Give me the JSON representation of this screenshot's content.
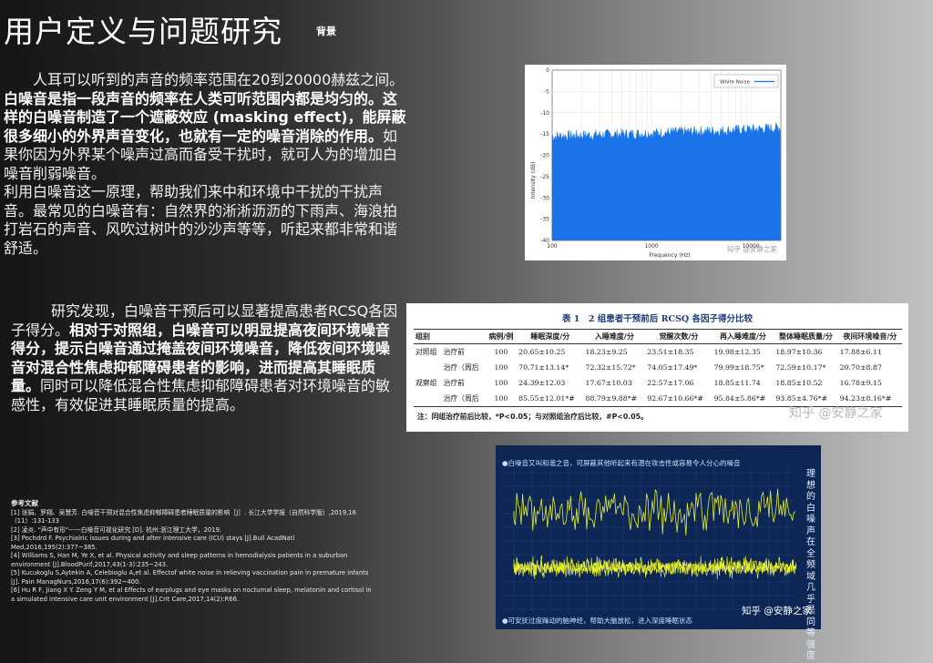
{
  "header": {
    "title": "用户定义与问题研究",
    "subtitle": "背景"
  },
  "para1": {
    "s1": "人耳可以听到的声音的频率范围在20到20000赫兹之间。",
    "s2": "白噪音是指一段声音的频率在人类可听范围内都是均匀的。这样的白噪音制造了一个遮蔽效应 (masking effect)，能屏蔽很多细小的外界声音变化，也就有一定的噪音消除的作用。",
    "s3": "如果你因为外界某个噪声过高而备受干扰时，就可人为的增加白噪音削弱噪音。",
    "s4": "利用白噪音这一原理，帮助我们来中和环境中干扰的干扰声音。最常见的白噪音有：自然界的淅淅沥沥的下雨声、海浪拍打岩石的声音、风吹过树叶的沙沙声等等，听起来都非常和谐舒适。"
  },
  "para2": {
    "s1": "研究发现，白噪音干预后可以显著提高患者RCSQ各因子得分。",
    "s2": "相对于对照组，白噪音可以明显提高夜间环境噪音得分，提示白噪音通过掩盖夜间环境噪音，降低夜间环境噪音对混合性焦虑抑郁障碍患者的影响，进而提高其睡眠质量。",
    "s3": "同时可以降低混合性焦虑抑郁障碍患者对环境噪音的敏感性，有效促进其睡眠质量的提高。"
  },
  "refs": {
    "heading": "参考文献",
    "items": [
      "[1] 张娟、罗翔、吴慧芳. 白噪音干预对混合性焦虑抑郁障碍患者睡眠质量的影响［J］. 长江大学学报（自然科学版）,2019,16（11）:131-133",
      "[2] 凌炎. \"声中有形\"——白噪音可视化研究 [D]. 杭州:浙江理工大学，2019.",
      "[3] Pochdrd F. Psychialric issues during and after intensive care (ICU) stays [J].Bull AcadNatl Med,2016,195(2):377~385.",
      "[4] Williams S, Han M, Ye X, et al. Physical activity and sleep patterns in hemodialysis patients in a suburban environment [J].BloodPurif,2017,43(1-3):235~243.",
      "[5] Kucukoglu S,Aytekin A, Celebioglu A,et al. Effectof white noise in relieving vaccination pain in premature infants [J]. Pain ManagNurs,2016,17(6):392~400.",
      "[6] Hu R F, Jiang X Y. Zeng Y M, et al Effects of earplugs and eye masks on nocturnal sleep, melatonin and cortisol in a simulated intensive care unit environment [J].Crit Care,2017,14(2):R66."
    ]
  },
  "chart_data": {
    "type": "area",
    "title": "",
    "xlabel": "Frequency (Hz)",
    "ylabel": "Intensity (dB)",
    "xscale": "log",
    "xlim": [
      100,
      20000
    ],
    "ylim": [
      -40,
      0
    ],
    "xticks": [
      "100",
      "1000",
      "10000"
    ],
    "yticks": [
      "0",
      "-5",
      "-10",
      "-15",
      "-20",
      "-25",
      "-30",
      "-35",
      "-40"
    ],
    "legend_position": "top-right",
    "series": [
      {
        "name": "White Noise",
        "color": "#1a73e8",
        "x": [
          100,
          200,
          500,
          1000,
          2000,
          5000,
          10000,
          20000
        ],
        "y": [
          -15.5,
          -15.3,
          -15.0,
          -14.8,
          -14.5,
          -14.2,
          -13.9,
          -13.5
        ]
      }
    ],
    "watermark": "知乎 @安静之家"
  },
  "table": {
    "title": "表 1　2 组患者干预前后 RCSQ 各因子得分比较",
    "headers": [
      "组别",
      "",
      "病例/例",
      "睡眠深度/分",
      "入睡难度/分",
      "觉醒次数/分",
      "再入睡难度/分",
      "整体睡眠质量/分",
      "夜间环境噪音/分"
    ],
    "rows": [
      [
        "对照组",
        "治疗前",
        "100",
        "20.65±10.25",
        "18.23±9.25",
        "23.51±18.35",
        "19.98±12.35",
        "18.97±10.36",
        "17.88±6.11"
      ],
      [
        "",
        "治疗（周后",
        "100",
        "70.71±13.14*",
        "72.32±15.72*",
        "74.05±17.49*",
        "79.99±18.75*",
        "72.59±10.17*",
        "20.70±8.87"
      ],
      [
        "观察组",
        "治疗前",
        "100",
        "24.39±12.03",
        "17.67±10.03",
        "22.57±17.06",
        "18.85±11.74",
        "18.85±10.52",
        "16.78±9.15"
      ],
      [
        "",
        "治疗（周后",
        "100",
        "85.55±12.01*#",
        "88.79±9.88*#",
        "92.67±10.66*#",
        "95.84±5.86*#",
        "93.85±4.76*#",
        "94.23±8.16*#"
      ]
    ],
    "note": "注：同组治疗前后比较，*P<0.05；与对照组治疗后比较，#P<0.05。",
    "watermark": "知乎 @安静之家"
  },
  "wave": {
    "caption_top": "●白噪音又叫和谐之音，可屏蔽其他听起来有潜在攻击性或容易令人分心的噪音",
    "caption_bottom": "●可安抚过度躁动的脑神经，帮助大脑放松，进入深度睡眠状态",
    "side_text": "理想的白噪声在全频域几乎是同等强度",
    "watermark": "知乎 @安静之家",
    "line_color": "#e6ef2d"
  }
}
